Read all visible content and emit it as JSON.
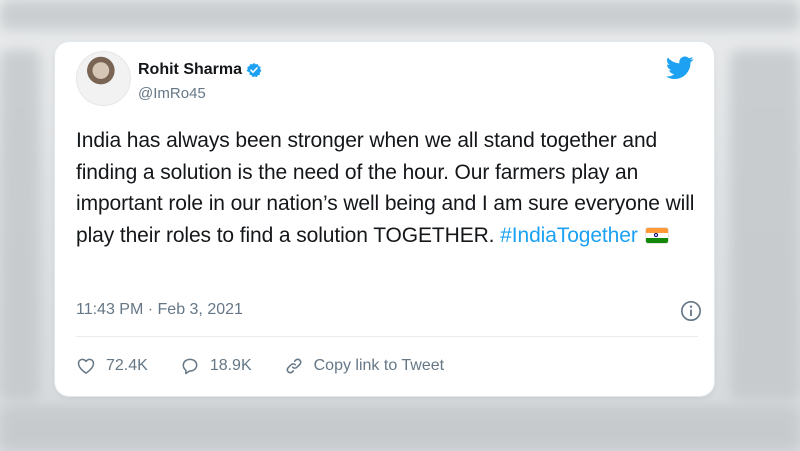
{
  "tweet": {
    "author_name": "Rohit Sharma",
    "author_handle": "@ImRo45",
    "text_plain": "India has always been stronger when we all stand together and finding a solution is the need of the hour. Our farmers play an important role in our nation’s well being and I am sure everyone will play their roles to find a solution TOGETHER.",
    "hashtag": "#IndiaTogether",
    "timestamp": "11:43 PM · Feb 3, 2021",
    "likes": "72.4K",
    "replies": "18.9K",
    "copy_link_label": "Copy link to Tweet",
    "icons": {
      "verified": "verified-badge-icon",
      "brand": "twitter-bird-icon",
      "info": "info-icon",
      "like": "heart-icon",
      "reply": "speech-bubble-icon",
      "link": "link-icon",
      "emoji": "india-flag-emoji"
    }
  },
  "colors": {
    "accent": "#1da1f2",
    "text": "#14171a",
    "secondary": "#657786",
    "divider": "#e6ecf0"
  }
}
